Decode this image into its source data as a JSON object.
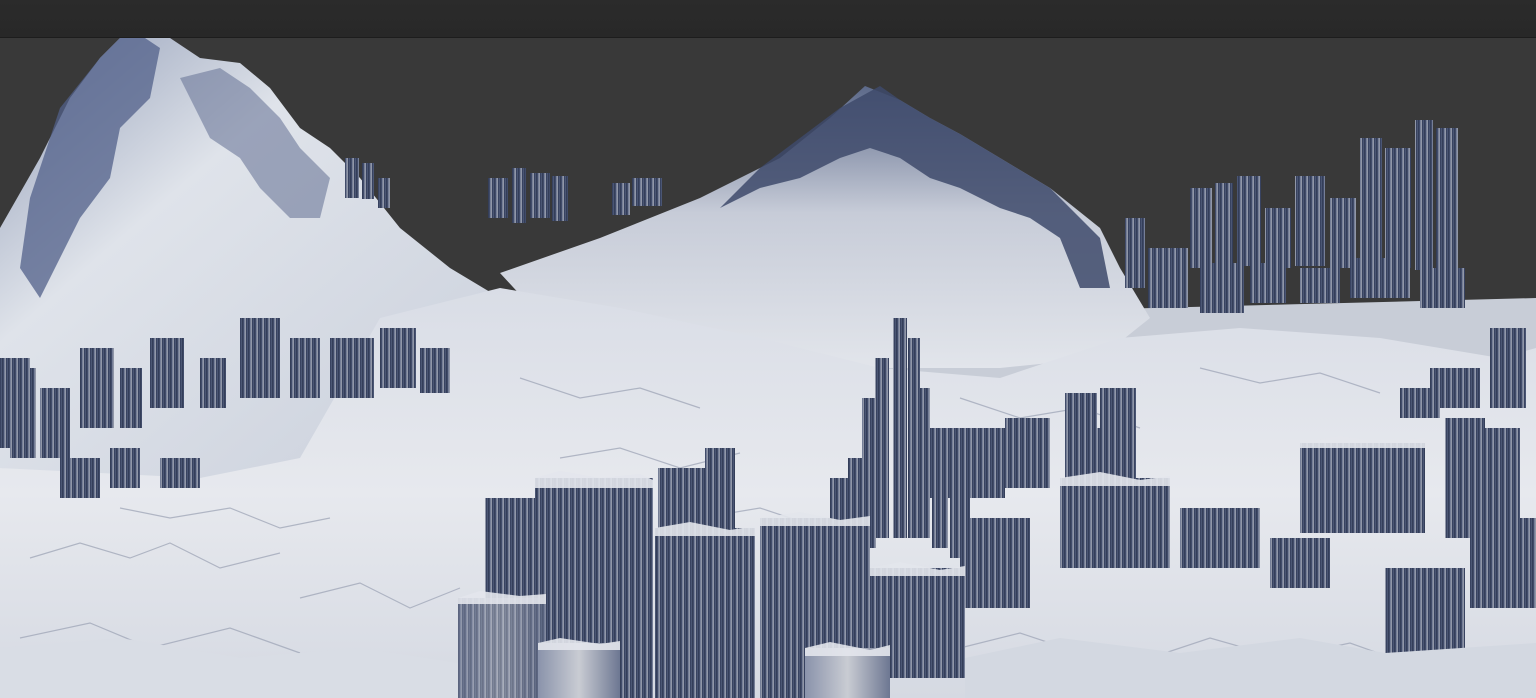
{
  "window": {
    "kind": "3d-viewport"
  },
  "scene": {
    "subject": "terrain",
    "colors": {
      "background": "#3a3a3a",
      "top_bar": "#2a2a2a",
      "terrain_light": "#e6e8ee",
      "terrain_mid": "#b9c0d0",
      "terrain_shadow": "#3b4766",
      "terrain_deep": "#252d44"
    }
  }
}
